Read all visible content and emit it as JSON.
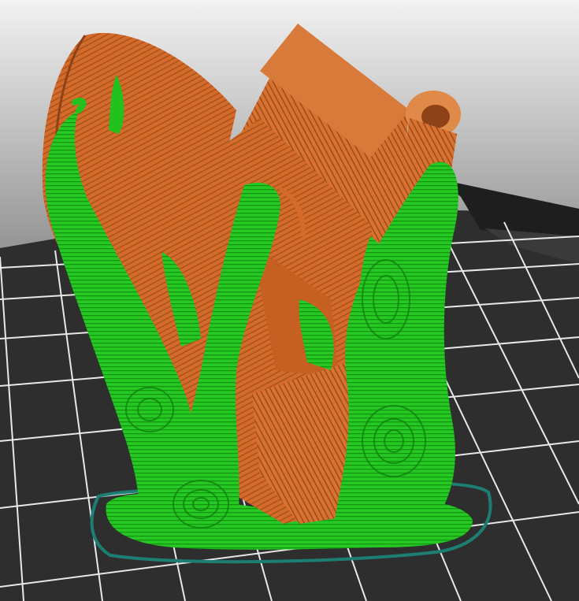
{
  "colors": {
    "background_top": "#f2f2f2",
    "background_mid": "#8c8c8c",
    "bed_surface": "#2b2b2b",
    "bed_grid_line": "#e6e6e6",
    "model_perimeter": "#d46b2a",
    "model_perimeter_shadow": "#8e4218",
    "support_material": "#22c21e",
    "support_shadow": "#0f7a0c",
    "skirt": "#1d7f74"
  },
  "scene": {
    "objects": [
      {
        "kind": "printed-model",
        "color_role": "model_perimeter"
      },
      {
        "kind": "tree-supports",
        "color_role": "support_material"
      },
      {
        "kind": "skirt-outline",
        "color_role": "skirt"
      },
      {
        "kind": "print-bed",
        "color_role": "bed_surface"
      }
    ]
  }
}
